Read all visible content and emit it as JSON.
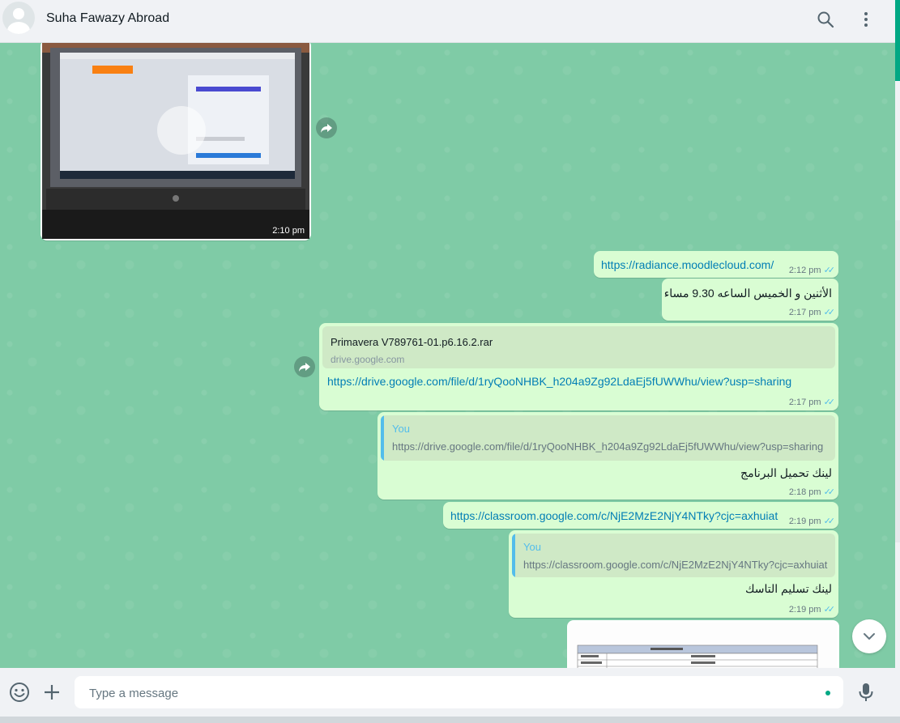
{
  "header": {
    "contact_name": "Suha Fawazy Abroad"
  },
  "icons": {
    "search": "search-icon",
    "menu": "menu-icon",
    "forward": "forward-icon",
    "emoji": "emoji-icon",
    "attach": "plus-icon",
    "mic": "mic-icon",
    "scroll_down": "chevron-down-icon"
  },
  "colors": {
    "outgoing_bubble": "#d9fdd3",
    "chat_bg": "#7fcba6",
    "link": "#027eb5",
    "read_ticks": "#53bdeb",
    "accent": "#00a884"
  },
  "messages": {
    "m1": {
      "time": "2:10 pm"
    },
    "m2": {
      "text": "https://radiance.moodlecloud.com/",
      "time": "2:12 pm"
    },
    "m3": {
      "text": "الأثنين و الخميس الساعه 9.30 مساء",
      "time": "2:17 pm"
    },
    "m4": {
      "preview_title": "Primavera V789761-01.p6.16.2.rar",
      "preview_domain": "drive.google.com",
      "text": "https://drive.google.com/file/d/1ryQooNHBK_h204a9Zg92LdaEj5fUWWhu/view?usp=sharing",
      "time": "2:17 pm"
    },
    "m5": {
      "quoted_author": "You",
      "quoted_text": "https://drive.google.com/file/d/1ryQooNHBK_h204a9Zg92LdaEj5fUWWhu/view?usp=sharing",
      "text": "لينك تحميل البرنامج",
      "time": "2:18 pm"
    },
    "m6": {
      "text": "https://classroom.google.com/c/NjE2MzE2NjY4NTky?cjc=axhuiat",
      "time": "2:19 pm"
    },
    "m7": {
      "quoted_author": "You",
      "quoted_text": "https://classroom.google.com/c/NjE2MzE2NjY4NTky?cjc=axhuiat",
      "text": "لينك تسليم التاسك",
      "time": "2:19 pm"
    }
  },
  "composer": {
    "placeholder": "Type a message"
  }
}
